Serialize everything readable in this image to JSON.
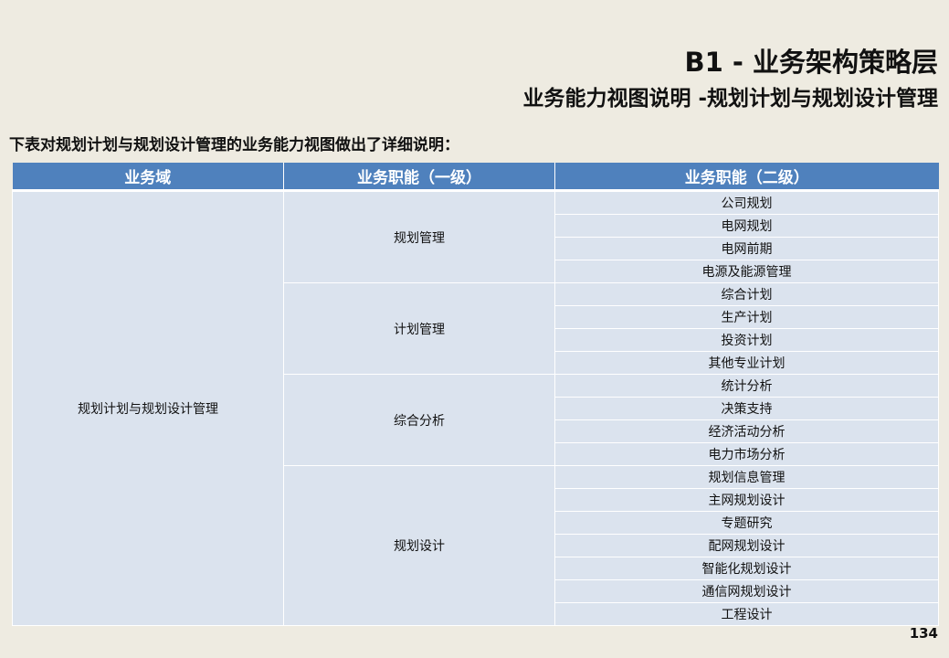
{
  "header": {
    "title": "B1 - 业务架构策略层",
    "subtitle": "业务能力视图说明 -规划计划与规划设计管理"
  },
  "intro": "下表对规划计划与规划设计管理的业务能力视图做出了详细说明：",
  "table": {
    "columns": [
      "业务域",
      "业务职能（一级）",
      "业务职能（二级）"
    ],
    "domain": "规划计划与规划设计管理",
    "groups": [
      {
        "level1": "规划管理",
        "level2": [
          "公司规划",
          "电网规划",
          "电网前期",
          "电源及能源管理"
        ]
      },
      {
        "level1": "计划管理",
        "level2": [
          "综合计划",
          "生产计划",
          "投资计划",
          "其他专业计划"
        ]
      },
      {
        "level1": "综合分析",
        "level2": [
          "统计分析",
          "决策支持",
          "经济活动分析",
          "电力市场分析"
        ]
      },
      {
        "level1": "规划设计",
        "level2": [
          "规划信息管理",
          "主网规划设计",
          "专题研究",
          "配网规划设计",
          "智能化规划设计",
          "通信网规划设计",
          "工程设计"
        ]
      }
    ]
  },
  "page_number": "134"
}
